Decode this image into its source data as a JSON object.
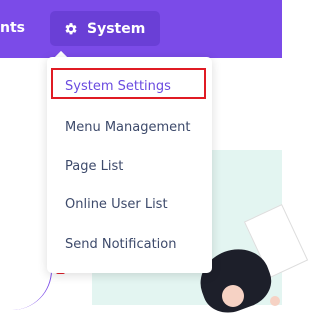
{
  "topbar": {
    "partial_nav_label": "nts",
    "system_label": "System",
    "system_icon": "gear-icon"
  },
  "dropdown": {
    "items": [
      {
        "label": "System Settings"
      },
      {
        "label": "Menu Management"
      },
      {
        "label": "Page List"
      },
      {
        "label": "Online User List"
      },
      {
        "label": "Send Notification"
      }
    ]
  },
  "colors": {
    "header": "#7b4be8",
    "active_item": "#6a4be0",
    "highlight": "#e01b24"
  }
}
